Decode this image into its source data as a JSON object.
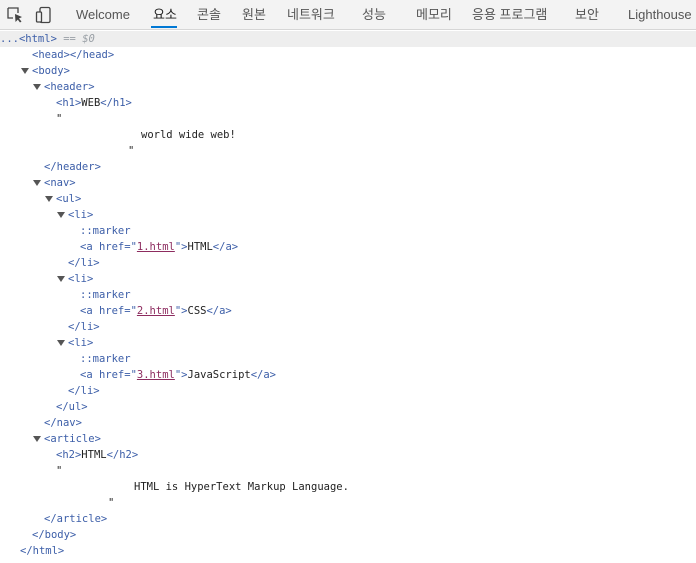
{
  "toolbar": {
    "icons": [
      "inspect-element-icon",
      "device-toolbar-icon"
    ],
    "tabs": [
      {
        "label": "Welcome"
      },
      {
        "label": "요소"
      },
      {
        "label": "콘솔"
      },
      {
        "label": "원본"
      },
      {
        "label": "네트워크"
      },
      {
        "label": "성능"
      },
      {
        "label": "메모리"
      },
      {
        "label": "응용 프로그램"
      },
      {
        "label": "보안"
      },
      {
        "label": "Lighthouse"
      }
    ],
    "active_tab": "요소"
  },
  "dom_tree": {
    "selected": {
      "ellipsis": "...",
      "open": "<html>",
      "eq": "== $0"
    },
    "head": "<head></head>",
    "body_open": "<body>",
    "header_open": "<header>",
    "h1_open": "<h1>",
    "h1_text": "WEB",
    "h1_close": "</h1>",
    "quote": "\"",
    "header_text": "world wide web!",
    "header_close": "</header>",
    "nav_open": "<nav>",
    "ul_open": "<ul>",
    "li_open": "<li>",
    "marker": "::marker",
    "a_open": "<a ",
    "href_attr": "href=\"",
    "attr_end": "\">",
    "a_close": "</a>",
    "li_close": "</li>",
    "links": [
      {
        "href": "1.html",
        "text": "HTML"
      },
      {
        "href": "2.html",
        "text": "CSS"
      },
      {
        "href": "3.html",
        "text": "JavaScript"
      }
    ],
    "ul_close": "</ul>",
    "nav_close": "</nav>",
    "article_open": "<article>",
    "h2_open": "<h2>",
    "h2_text": "HTML",
    "h2_close": "</h2>",
    "article_text": "HTML is HyperText Markup Language.",
    "article_close": "</article>",
    "body_close": "</body>",
    "html_close": "</html>"
  },
  "colors": {
    "tag": "#3c5ea8",
    "attr_value": "#8d2c5f",
    "accent": "#0078d4"
  }
}
